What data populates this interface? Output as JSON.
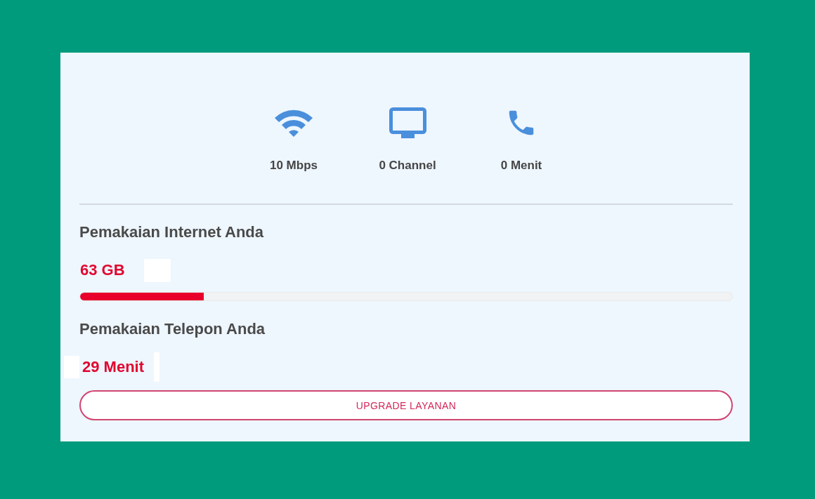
{
  "stats": [
    {
      "kind": "wifi",
      "label": "10 Mbps"
    },
    {
      "kind": "tv",
      "label": "0 Channel"
    },
    {
      "kind": "phone",
      "label": "0 Menit"
    }
  ],
  "internet_usage": {
    "heading": "Pemakaian Internet Anda",
    "value": "63 GB",
    "level": 0.19
  },
  "phone_usage": {
    "heading": "Pemakaian Telepon Anda",
    "value": "29 Menit"
  },
  "button": {
    "label": "UPGRADE LAYANAN"
  }
}
